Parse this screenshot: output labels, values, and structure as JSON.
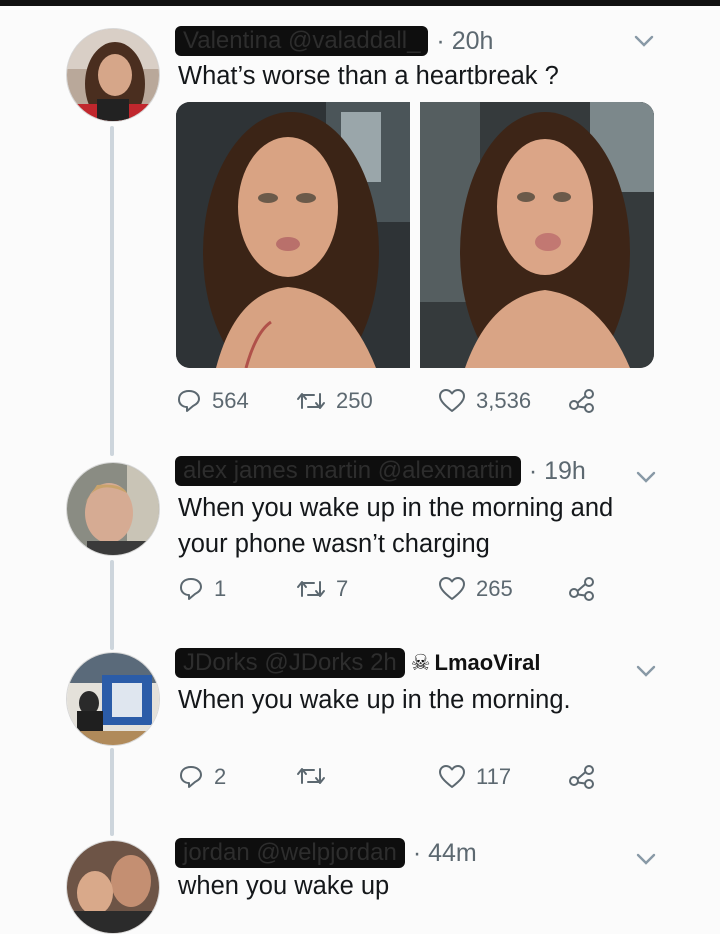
{
  "tweets": [
    {
      "name": "Valentina",
      "handle": "@valaddall_",
      "time": "· 20h",
      "text": "What’s worse than a heartbreak ?",
      "replies": "564",
      "retweets": "250",
      "likes": "3,536"
    },
    {
      "name": "alex james martin",
      "handle": "@alexmartin",
      "time": "· 19h",
      "text_line1": "When you wake up in the morning and",
      "text_line2": "your phone wasn’t charging",
      "replies": "1",
      "retweets": "7",
      "likes": "265"
    },
    {
      "name": "JDorks",
      "handle": "@JDorks",
      "time": "2h",
      "watermark": "LmaoViral",
      "text": "When you wake up in the morning.",
      "replies": "2",
      "retweets": "",
      "likes": "117"
    },
    {
      "name": "jordan",
      "handle": "@welpjordan",
      "time": "· 44m",
      "text": "when you wake up"
    }
  ],
  "icons": {
    "reply": "reply-bubble-icon",
    "retweet": "retweet-icon",
    "like": "heart-icon",
    "share": "share-icon",
    "caret": "chevron-down-icon"
  },
  "colors": {
    "text": "#14171a",
    "secondary": "#5c6870",
    "thread_line": "#cdd5dc"
  }
}
